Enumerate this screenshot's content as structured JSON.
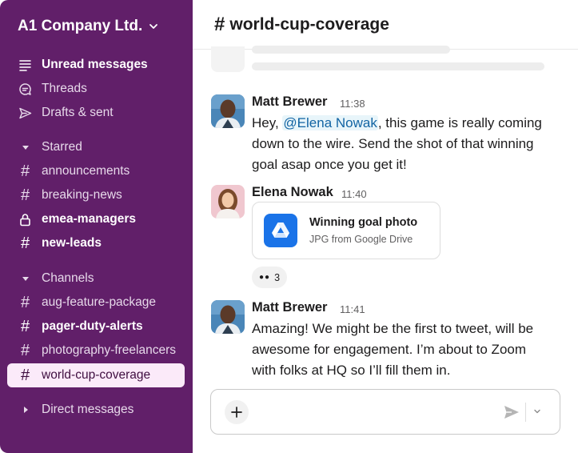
{
  "workspace": {
    "name": "A1 Company Ltd."
  },
  "sidebar": {
    "nav": [
      {
        "label": "Unread messages",
        "icon": "unread-icon"
      },
      {
        "label": "Threads",
        "icon": "threads-icon"
      },
      {
        "label": "Drafts & sent",
        "icon": "send-icon"
      }
    ],
    "starred": {
      "label": "Starred",
      "channels": [
        "announcements",
        "breaking-news",
        "emea-managers",
        "new-leads"
      ]
    },
    "channels": {
      "label": "Channels",
      "items": [
        "aug-feature-package",
        "pager-duty-alerts",
        "photography-freelancers",
        "world-cup-coverage"
      ]
    },
    "direct_messages": {
      "label": "Direct messages"
    }
  },
  "channel": {
    "hash": "#",
    "name": "world-cup-coverage"
  },
  "messages": [
    {
      "author": "Matt Brewer",
      "time": "11:38",
      "lines": [
        "this game is really coming",
        "down to the wire. Send the shot of that winning",
        "goal asap once you get it!"
      ],
      "prefix": "Hey, ",
      "mention": "@Elena Nowak",
      "after_mention": ", this game is really coming"
    },
    {
      "author": "Elena Nowak",
      "time": "11:40",
      "attachment": {
        "title": "Winning goal photo",
        "subtitle": "JPG from Google Drive",
        "icon": "google-drive-icon"
      },
      "reaction": {
        "emoji": "👀",
        "count": "3"
      }
    },
    {
      "author": "Matt Brewer",
      "time": "11:41",
      "lines": [
        "Amazing! We might be the first to tweet, will be",
        "awesome for engagement. I’m about to Zoom",
        "with folks at HQ so I’ll fill them in."
      ]
    }
  ],
  "composer": {
    "placeholder": ""
  },
  "colors": {
    "sidebar": "#611f69",
    "active_item": "#fbeaf9",
    "mention": "#1264a3",
    "drive_icon": "#1a73e8"
  }
}
